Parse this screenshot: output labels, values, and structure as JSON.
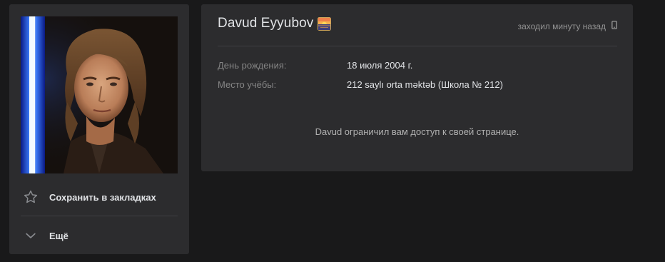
{
  "profile": {
    "name": "Davud Eyyubov",
    "status_emoji": "sunset-emoji-icon",
    "last_seen": "заходил минуту назад",
    "device_icon": "mobile-phone-icon"
  },
  "info": {
    "birthday_label": "День рождения:",
    "birthday_value": "18 июля 2004 г.",
    "school_label": "Место учёбы:",
    "school_value": "212 saylı orta məktəb (Школа № 212)"
  },
  "restriction_message": "Davud ограничил вам доступ к своей странице.",
  "actions": {
    "save_label": "Сохранить в закладках",
    "more_label": "Ещё"
  },
  "colors": {
    "background": "#19191a",
    "card": "#2c2c2e",
    "text_primary": "#e1e3e6",
    "text_secondary": "#858585"
  }
}
